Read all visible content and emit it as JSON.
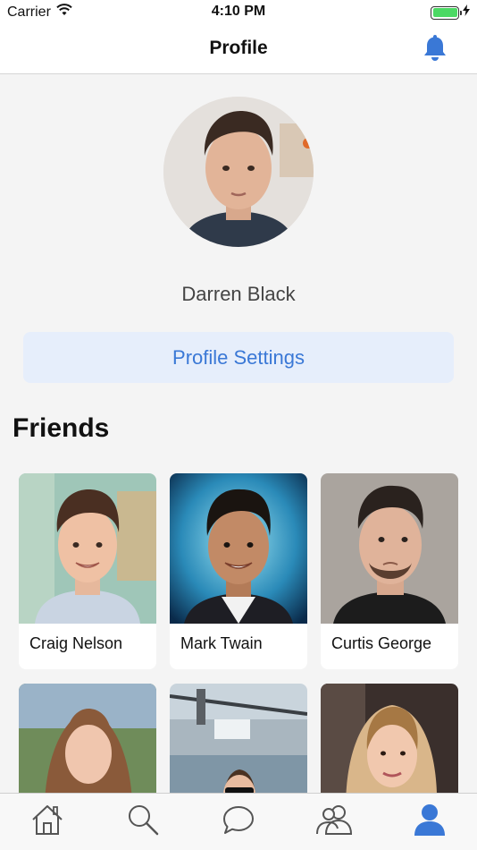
{
  "status": {
    "carrier": "Carrier",
    "time": "4:10 PM"
  },
  "nav": {
    "title": "Profile"
  },
  "profile": {
    "name": "Darren Black",
    "settings_label": "Profile Settings"
  },
  "friends": {
    "title": "Friends",
    "items": [
      {
        "name": "Craig Nelson"
      },
      {
        "name": "Mark Twain"
      },
      {
        "name": "Curtis George"
      },
      {
        "name": ""
      },
      {
        "name": ""
      },
      {
        "name": ""
      }
    ]
  },
  "tabs": [
    {
      "icon": "home-icon"
    },
    {
      "icon": "search-icon"
    },
    {
      "icon": "chat-icon"
    },
    {
      "icon": "friends-icon"
    },
    {
      "icon": "profile-icon",
      "active": true
    }
  ],
  "colors": {
    "accent": "#3a78d6",
    "tab_inactive": "#555555",
    "battery": "#4cd964"
  }
}
